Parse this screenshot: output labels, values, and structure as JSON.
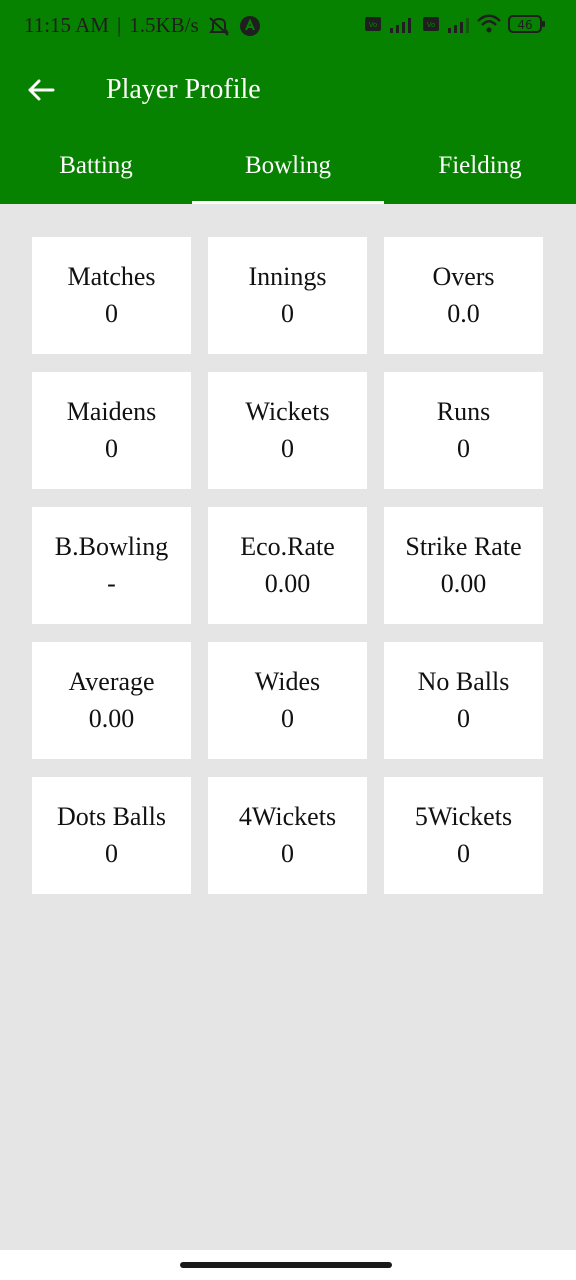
{
  "status_bar": {
    "time": "11:15 AM",
    "separator": "|",
    "speed": "1.5KB/s",
    "battery": "46",
    "icons": [
      "mute-icon",
      "app-icon",
      "volte-icon",
      "signal-icon",
      "wifi-icon",
      "battery-icon"
    ]
  },
  "toolbar": {
    "title": "Player Profile",
    "back_icon": "arrow-left-icon"
  },
  "tabs": [
    {
      "label": "Batting",
      "active": false
    },
    {
      "label": "Bowling",
      "active": true
    },
    {
      "label": "Fielding",
      "active": false
    }
  ],
  "stats": [
    {
      "label": "Matches",
      "value": "0"
    },
    {
      "label": "Innings",
      "value": "0"
    },
    {
      "label": "Overs",
      "value": "0.0"
    },
    {
      "label": "Maidens",
      "value": "0"
    },
    {
      "label": "Wickets",
      "value": "0"
    },
    {
      "label": "Runs",
      "value": "0"
    },
    {
      "label": "B.Bowling",
      "value": "-"
    },
    {
      "label": "Eco.Rate",
      "value": "0.00"
    },
    {
      "label": "Strike Rate",
      "value": "0.00"
    },
    {
      "label": "Average",
      "value": "0.00"
    },
    {
      "label": "Wides",
      "value": "0"
    },
    {
      "label": "No Balls",
      "value": "0"
    },
    {
      "label": "Dots Balls",
      "value": "0"
    },
    {
      "label": "4Wickets",
      "value": "0"
    },
    {
      "label": "5Wickets",
      "value": "0"
    }
  ],
  "colors": {
    "primary": "#078100",
    "background": "#e5e5e5",
    "card": "#ffffff"
  }
}
